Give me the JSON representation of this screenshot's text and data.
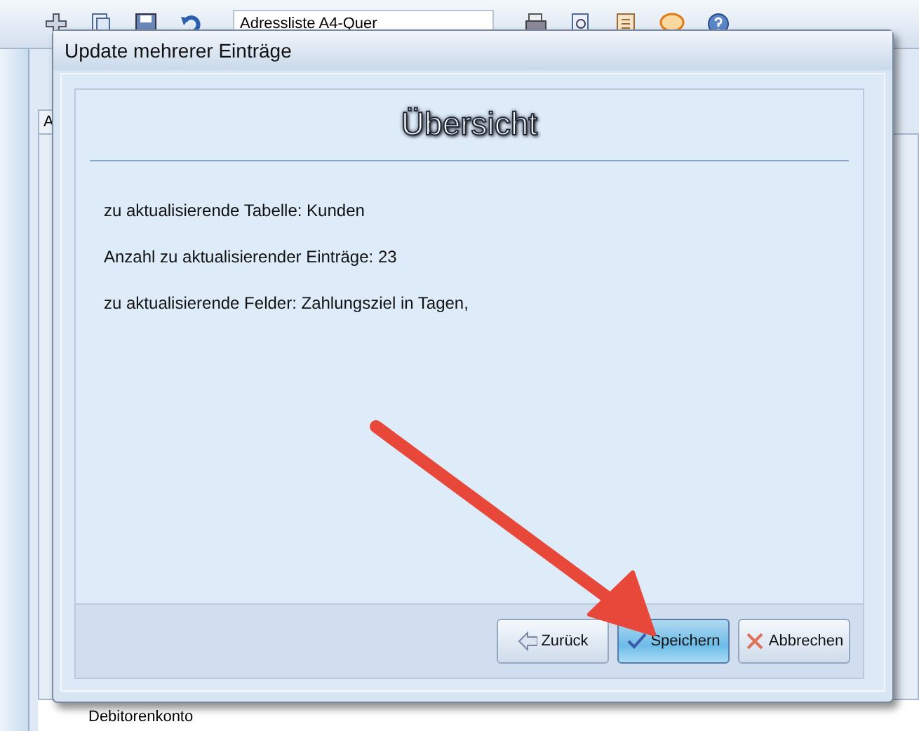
{
  "app": {
    "toolbar": {
      "report_field": {
        "value": "Adressliste A4-Quer"
      }
    },
    "tab": {
      "label": "A"
    },
    "bottom_row": {
      "label": "Debitorenkonto"
    }
  },
  "dialog": {
    "title": "Update mehrerer Einträge",
    "heading": "Übersicht",
    "lines": [
      {
        "label": "zu aktualisierende Tabelle:",
        "value": "Kunden"
      },
      {
        "label": "Anzahl zu aktualisierender Einträge:",
        "value": "23"
      },
      {
        "label": "zu aktualisierende Felder:",
        "value": "Zahlungsziel in Tagen,"
      }
    ],
    "buttons": [
      {
        "kind": "back",
        "label": "Zurück",
        "highlighted": false
      },
      {
        "kind": "save",
        "label": "Speichern",
        "highlighted": true
      },
      {
        "kind": "cancel",
        "label": "Abbrechen",
        "highlighted": false
      }
    ]
  },
  "annotation": {
    "kind": "arrow"
  }
}
